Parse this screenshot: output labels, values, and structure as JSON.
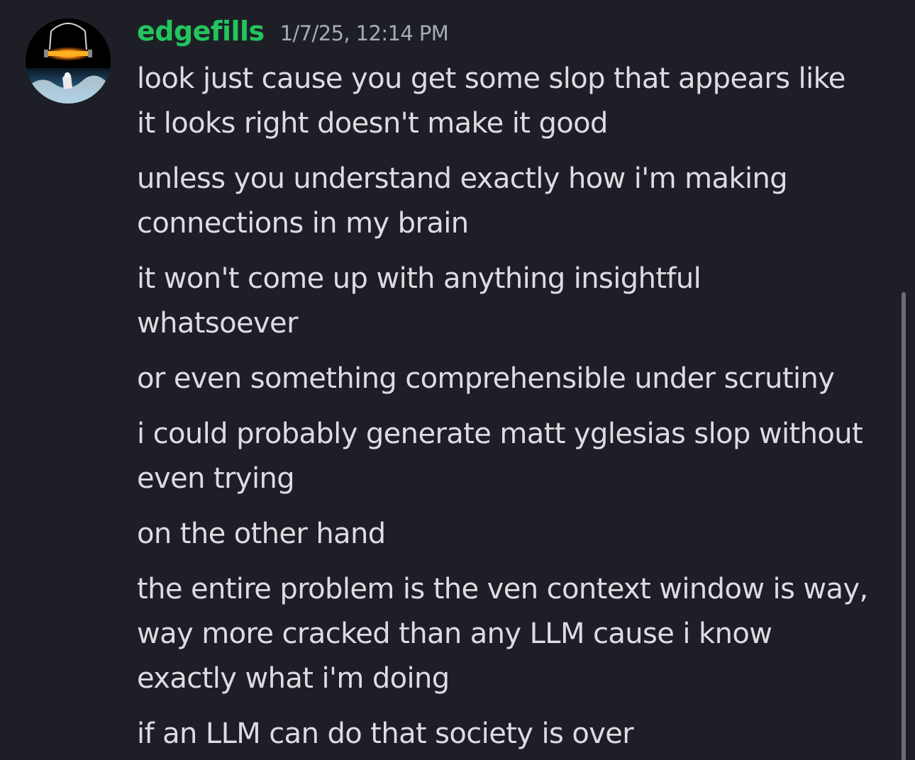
{
  "message": {
    "username": "edgefills",
    "timestamp": "1/7/25, 12:14 PM",
    "lines": [
      "look just cause you get some slop that appears like\nit looks right doesn't make it good",
      "unless you understand exactly how i'm making\nconnections in my brain",
      "it won't come up with anything insightful\nwhatsoever",
      "or even something comprehensible under scrutiny",
      "i could probably generate matt yglesias slop without\neven trying",
      "on the other hand",
      "the entire problem is the ven context window is way,\nway more cracked than any LLM cause i know\nexactly what i'm doing",
      "if an LLM can do that society is over"
    ]
  },
  "colors": {
    "background": "#1e1f26",
    "username": "#22c55e",
    "timestamp": "#a8aab4",
    "text": "#dcdde2",
    "scrollbar": "#6b6c74"
  }
}
